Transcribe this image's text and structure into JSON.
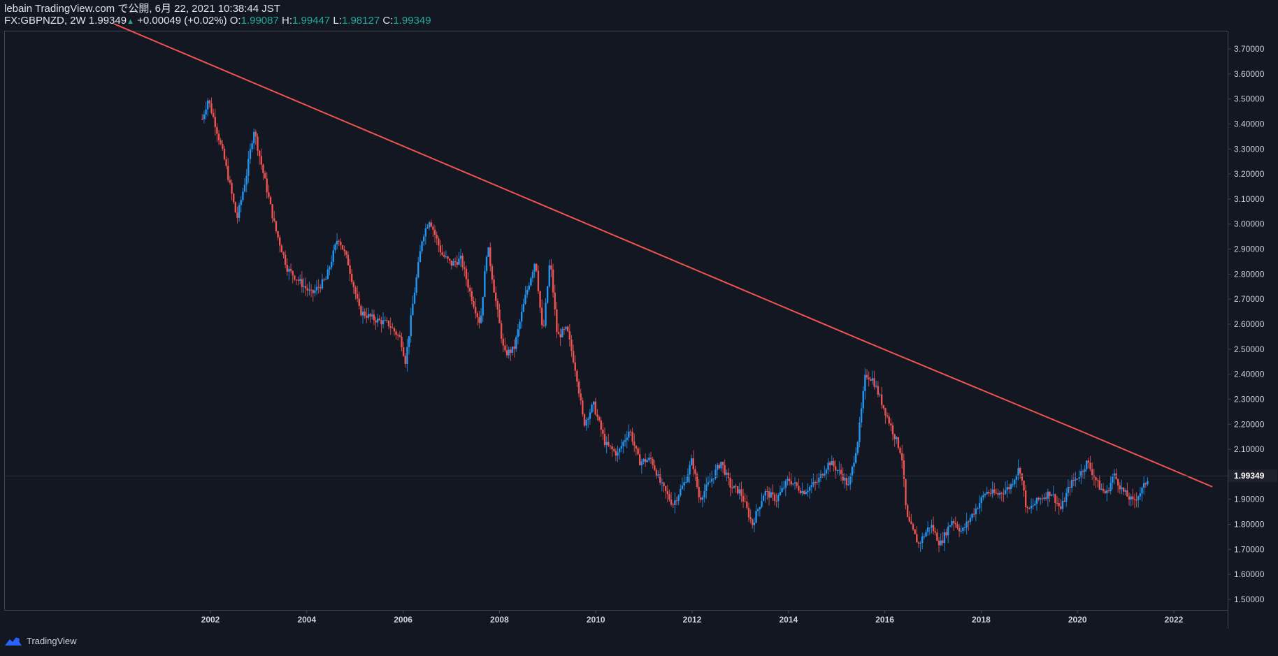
{
  "header": {
    "line1": "lebain TradingView.com で公開, 6月 22, 2021 10:38:44 JST",
    "symbol": "FX:GBPNZD, 2W",
    "last": "1.99349",
    "arrow": "▲",
    "change": "+0.00049 (+0.02%)",
    "o_label": "O:",
    "o_value": "1.99087",
    "h_label": "H:",
    "h_value": "1.99447",
    "l_label": "L:",
    "l_value": "1.98127",
    "c_label": "C:",
    "c_value": "1.99349"
  },
  "footer": {
    "brand": "TradingView"
  },
  "colors": {
    "background": "#131722",
    "up": "#2196f3",
    "down": "#ef5350",
    "trendline": "#ef5350",
    "axis_text": "#d1d4dc",
    "price_label_bg": "#1e222d",
    "logo": "#2962ff"
  },
  "chart_data": {
    "type": "candlestick",
    "title": "FX:GBPNZD, 2W",
    "xlabel": "",
    "ylabel": "",
    "x_ticks": [
      "2002",
      "2004",
      "2006",
      "2008",
      "2010",
      "2012",
      "2014",
      "2016",
      "2018",
      "2020",
      "2022"
    ],
    "y_ticks": [
      "3.70000",
      "3.60000",
      "3.50000",
      "3.40000",
      "3.30000",
      "3.20000",
      "3.10000",
      "3.00000",
      "2.90000",
      "2.80000",
      "2.70000",
      "2.60000",
      "2.50000",
      "2.40000",
      "2.30000",
      "2.20000",
      "2.10000",
      "1.90000",
      "1.80000",
      "1.70000",
      "1.60000",
      "1.50000"
    ],
    "ylim": [
      1.5,
      3.73
    ],
    "xlim": [
      2000.0,
      2022.8
    ],
    "current_price": "1.99349",
    "price_path": [
      [
        2001.83,
        3.42
      ],
      [
        2001.95,
        3.5
      ],
      [
        2002.1,
        3.4
      ],
      [
        2002.3,
        3.25
      ],
      [
        2002.55,
        3.02
      ],
      [
        2002.75,
        3.2
      ],
      [
        2002.9,
        3.38
      ],
      [
        2003.1,
        3.2
      ],
      [
        2003.35,
        2.98
      ],
      [
        2003.6,
        2.82
      ],
      [
        2003.9,
        2.76
      ],
      [
        2004.1,
        2.72
      ],
      [
        2004.4,
        2.78
      ],
      [
        2004.65,
        2.95
      ],
      [
        2004.85,
        2.85
      ],
      [
        2005.1,
        2.65
      ],
      [
        2005.4,
        2.62
      ],
      [
        2005.7,
        2.6
      ],
      [
        2005.95,
        2.54
      ],
      [
        2006.05,
        2.45
      ],
      [
        2006.2,
        2.68
      ],
      [
        2006.4,
        2.95
      ],
      [
        2006.55,
        3.02
      ],
      [
        2006.8,
        2.88
      ],
      [
        2007.0,
        2.84
      ],
      [
        2007.2,
        2.86
      ],
      [
        2007.4,
        2.72
      ],
      [
        2007.6,
        2.6
      ],
      [
        2007.75,
        2.92
      ],
      [
        2007.9,
        2.72
      ],
      [
        2008.1,
        2.48
      ],
      [
        2008.3,
        2.5
      ],
      [
        2008.55,
        2.72
      ],
      [
        2008.75,
        2.86
      ],
      [
        2008.9,
        2.55
      ],
      [
        2009.05,
        2.86
      ],
      [
        2009.2,
        2.55
      ],
      [
        2009.4,
        2.58
      ],
      [
        2009.6,
        2.4
      ],
      [
        2009.75,
        2.2
      ],
      [
        2009.95,
        2.28
      ],
      [
        2010.2,
        2.12
      ],
      [
        2010.45,
        2.08
      ],
      [
        2010.7,
        2.18
      ],
      [
        2010.9,
        2.05
      ],
      [
        2011.15,
        2.06
      ],
      [
        2011.35,
        1.96
      ],
      [
        2011.6,
        1.88
      ],
      [
        2011.85,
        1.97
      ],
      [
        2012.0,
        2.06
      ],
      [
        2012.15,
        1.9
      ],
      [
        2012.4,
        1.98
      ],
      [
        2012.6,
        2.05
      ],
      [
        2012.8,
        1.95
      ],
      [
        2013.0,
        1.93
      ],
      [
        2013.25,
        1.8
      ],
      [
        2013.5,
        1.93
      ],
      [
        2013.75,
        1.9
      ],
      [
        2014.0,
        1.98
      ],
      [
        2014.3,
        1.93
      ],
      [
        2014.6,
        1.97
      ],
      [
        2014.85,
        2.05
      ],
      [
        2015.1,
        2.0
      ],
      [
        2015.25,
        1.95
      ],
      [
        2015.45,
        2.15
      ],
      [
        2015.6,
        2.4
      ],
      [
        2015.75,
        2.38
      ],
      [
        2015.95,
        2.28
      ],
      [
        2016.15,
        2.18
      ],
      [
        2016.35,
        2.08
      ],
      [
        2016.45,
        1.83
      ],
      [
        2016.7,
        1.72
      ],
      [
        2016.95,
        1.8
      ],
      [
        2017.15,
        1.72
      ],
      [
        2017.4,
        1.82
      ],
      [
        2017.6,
        1.77
      ],
      [
        2017.85,
        1.85
      ],
      [
        2018.1,
        1.93
      ],
      [
        2018.35,
        1.92
      ],
      [
        2018.6,
        1.95
      ],
      [
        2018.8,
        2.03
      ],
      [
        2018.95,
        1.85
      ],
      [
        2019.2,
        1.9
      ],
      [
        2019.45,
        1.93
      ],
      [
        2019.65,
        1.86
      ],
      [
        2019.85,
        1.96
      ],
      [
        2020.05,
        2.0
      ],
      [
        2020.2,
        2.05
      ],
      [
        2020.45,
        1.95
      ],
      [
        2020.6,
        1.92
      ],
      [
        2020.75,
        2.0
      ],
      [
        2020.95,
        1.93
      ],
      [
        2021.15,
        1.89
      ],
      [
        2021.35,
        1.94
      ],
      [
        2021.48,
        1.99349
      ]
    ],
    "trendline": {
      "color": "#ef5350",
      "points": [
        [
          2000.0,
          3.8
        ],
        [
          2015.6,
          2.53
        ],
        [
          2020.1,
          2.17
        ],
        [
          2022.8,
          1.95
        ]
      ]
    }
  }
}
